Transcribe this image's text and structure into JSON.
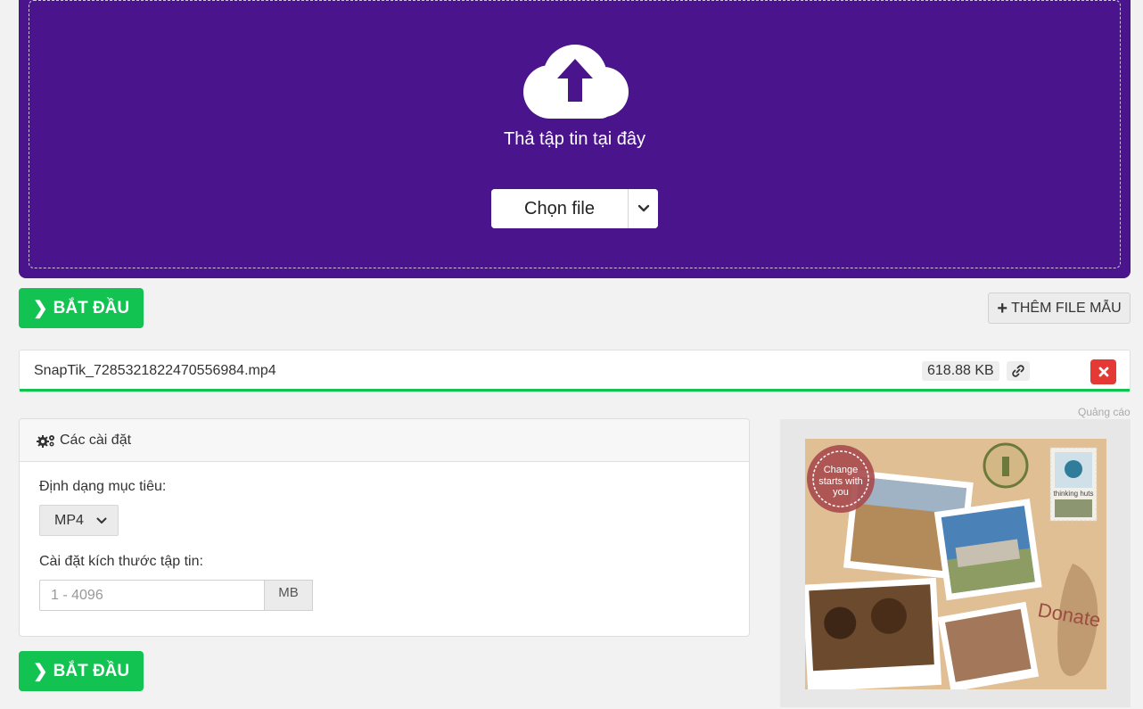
{
  "dropzone": {
    "drop_text": "Thả tập tin tại đây",
    "choose_label": "Chọn file",
    "bg_color": "#4a148c"
  },
  "actions": {
    "start_label": "BẮT ĐẦU",
    "sample_label": "THÊM FILE MẪU",
    "accent_color": "#12c352"
  },
  "file": {
    "name": "SnapTik_7285321822470556984.mp4",
    "size": "618.88 KB",
    "progress": 1.0
  },
  "ad": {
    "label": "Quảng cáo",
    "stamp_text": "Change starts with you",
    "tag_text": "thinking huts",
    "donate_text": "Donate"
  },
  "settings": {
    "title": "Các cài đặt",
    "format_label": "Định dạng mục tiêu:",
    "format_value": "MP4",
    "size_label": "Cài đặt kích thước tập tin:",
    "size_placeholder": "1 - 4096",
    "size_unit": "MB"
  },
  "icons": {
    "upload": "cloud-upload-icon",
    "chevron": "chevron-down-icon",
    "start": "chevron-right-icon",
    "plus": "plus-icon",
    "link": "link-icon",
    "remove": "close-icon",
    "settings": "gears-icon"
  }
}
